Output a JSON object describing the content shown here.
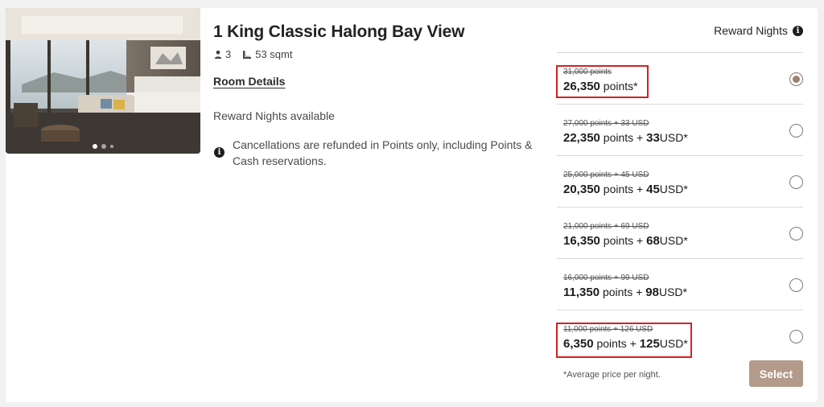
{
  "room": {
    "title": "1 King Classic Halong Bay View",
    "guests": "3",
    "size": "53 sqmt",
    "details_link": "Room Details",
    "reward_available": "Reward Nights available",
    "cancellation": "Cancellations are refunded in Points only, including Points & Cash reservations.",
    "photo_count": 3,
    "photo_active_index": 0
  },
  "rates": {
    "header": "Reward Nights",
    "options": [
      {
        "old": "31,000 points",
        "amount": "26,350",
        "unit": "points*",
        "cash": "",
        "cash_unit": "",
        "selected": true,
        "highlighted": true
      },
      {
        "old": "27,000 points + 33 USD",
        "amount": "22,350",
        "unit": "points",
        "plus": "+",
        "cash": "33",
        "cash_unit": "USD*",
        "selected": false,
        "highlighted": false
      },
      {
        "old": "25,000 points + 45 USD",
        "amount": "20,350",
        "unit": "points",
        "plus": "+",
        "cash": "45",
        "cash_unit": "USD*",
        "selected": false,
        "highlighted": false
      },
      {
        "old": "21,000 points + 69 USD",
        "amount": "16,350",
        "unit": "points",
        "plus": "+",
        "cash": "68",
        "cash_unit": "USD*",
        "selected": false,
        "highlighted": false
      },
      {
        "old": "16,000 points + 99 USD",
        "amount": "11,350",
        "unit": "points",
        "plus": "+",
        "cash": "98",
        "cash_unit": "USD*",
        "selected": false,
        "highlighted": false
      },
      {
        "old": "11,000 points + 126 USD",
        "amount": "6,350",
        "unit": "points",
        "plus": "+",
        "cash": "125",
        "cash_unit": "USD*",
        "selected": false,
        "highlighted": true
      }
    ],
    "note": "*Average price per night.",
    "select_label": "Select"
  },
  "colors": {
    "accent": "#b39a8b",
    "radio_selected": "#9c8272",
    "highlight": "#d42121"
  }
}
